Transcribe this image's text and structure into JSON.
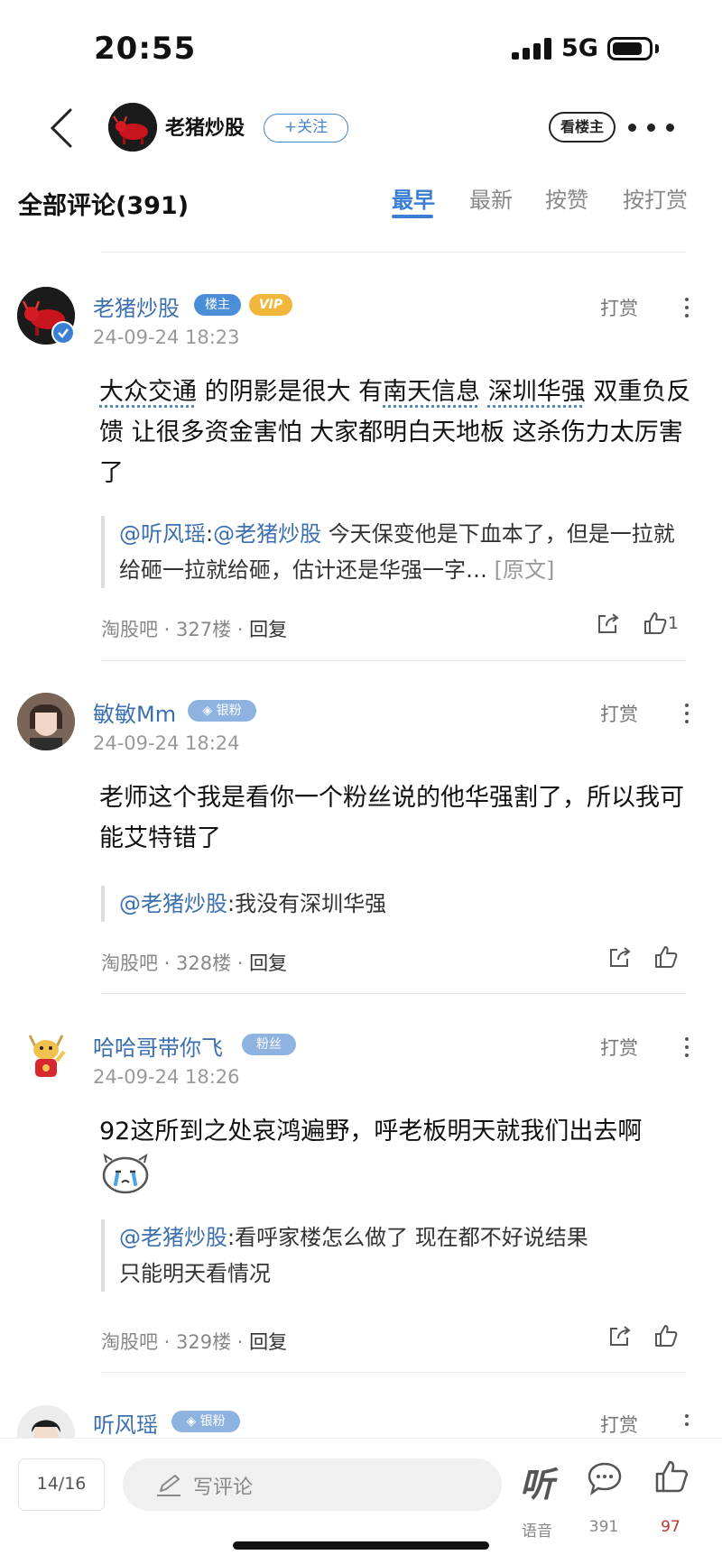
{
  "status_bar": {
    "time": "20:55",
    "network": "5G"
  },
  "header": {
    "author_name": "老猪炒股",
    "follow_label": "+关注",
    "op_only_label": "看楼主"
  },
  "comments_header": {
    "title": "全部评论(391)",
    "sort_tabs": [
      "最早",
      "最新",
      "按赞",
      "按打赏"
    ],
    "active_tab": "最早"
  },
  "comments": [
    {
      "name": "老猪炒股",
      "tags": [
        "楼主",
        "VIP"
      ],
      "time": "24-09-24 18:23",
      "tip_label": "打赏",
      "body_parts": [
        "大众交通",
        " 的阴影是很大 有",
        "南天信息",
        " ",
        "深圳华强",
        " 双重负反馈 让很多资金害怕 大家都明白天地板 这杀伤力太厉害了"
      ],
      "quote_name": "@听风瑶",
      "quote_sep": ":",
      "quote_mention": "@老猪炒股",
      "quote_text": " 今天保变他是下血本了，但是一拉就给砸一拉就给砸，估计还是华强一字…",
      "quote_more": " [原文]",
      "source": "淘股吧",
      "floor": "327楼",
      "reply_label": "回复",
      "like_count": "1"
    },
    {
      "name": "敏敏Mm",
      "tags": [
        "银粉"
      ],
      "time": "24-09-24 18:24",
      "tip_label": "打赏",
      "body": "老师这个我是看你一个粉丝说的他华强割了，所以我可能艾特错了",
      "quote_name": "@老猪炒股",
      "quote_text": ":我没有深圳华强",
      "source": "淘股吧",
      "floor": "328楼",
      "reply_label": "回复"
    },
    {
      "name": "哈哈哥带你飞",
      "tags": [
        "粉丝"
      ],
      "time": "24-09-24 18:26",
      "tip_label": "打赏",
      "body": "92这所到之处哀鸿遍野，呼老板明天就我们出去啊",
      "quote_name": "@老猪炒股",
      "quote_text": ":看呼家楼怎么做了 现在都不好说结果",
      "quote_text2": "只能明天看情况",
      "source": "淘股吧",
      "floor": "329楼",
      "reply_label": "回复"
    },
    {
      "name": "听风瑶",
      "tags": [
        "银粉"
      ],
      "tip_label": "打赏"
    }
  ],
  "bottom_bar": {
    "page_indicator": "14/16",
    "comment_placeholder": "写评论",
    "listen_glyph": "听",
    "listen_label": "语音",
    "comment_count": "391",
    "like_count": "97"
  },
  "colors": {
    "accent": "#3b7fd4",
    "name_blue": "#3b6fb0",
    "like_red": "#b8342f",
    "vip_gold": "#f0b73c"
  }
}
